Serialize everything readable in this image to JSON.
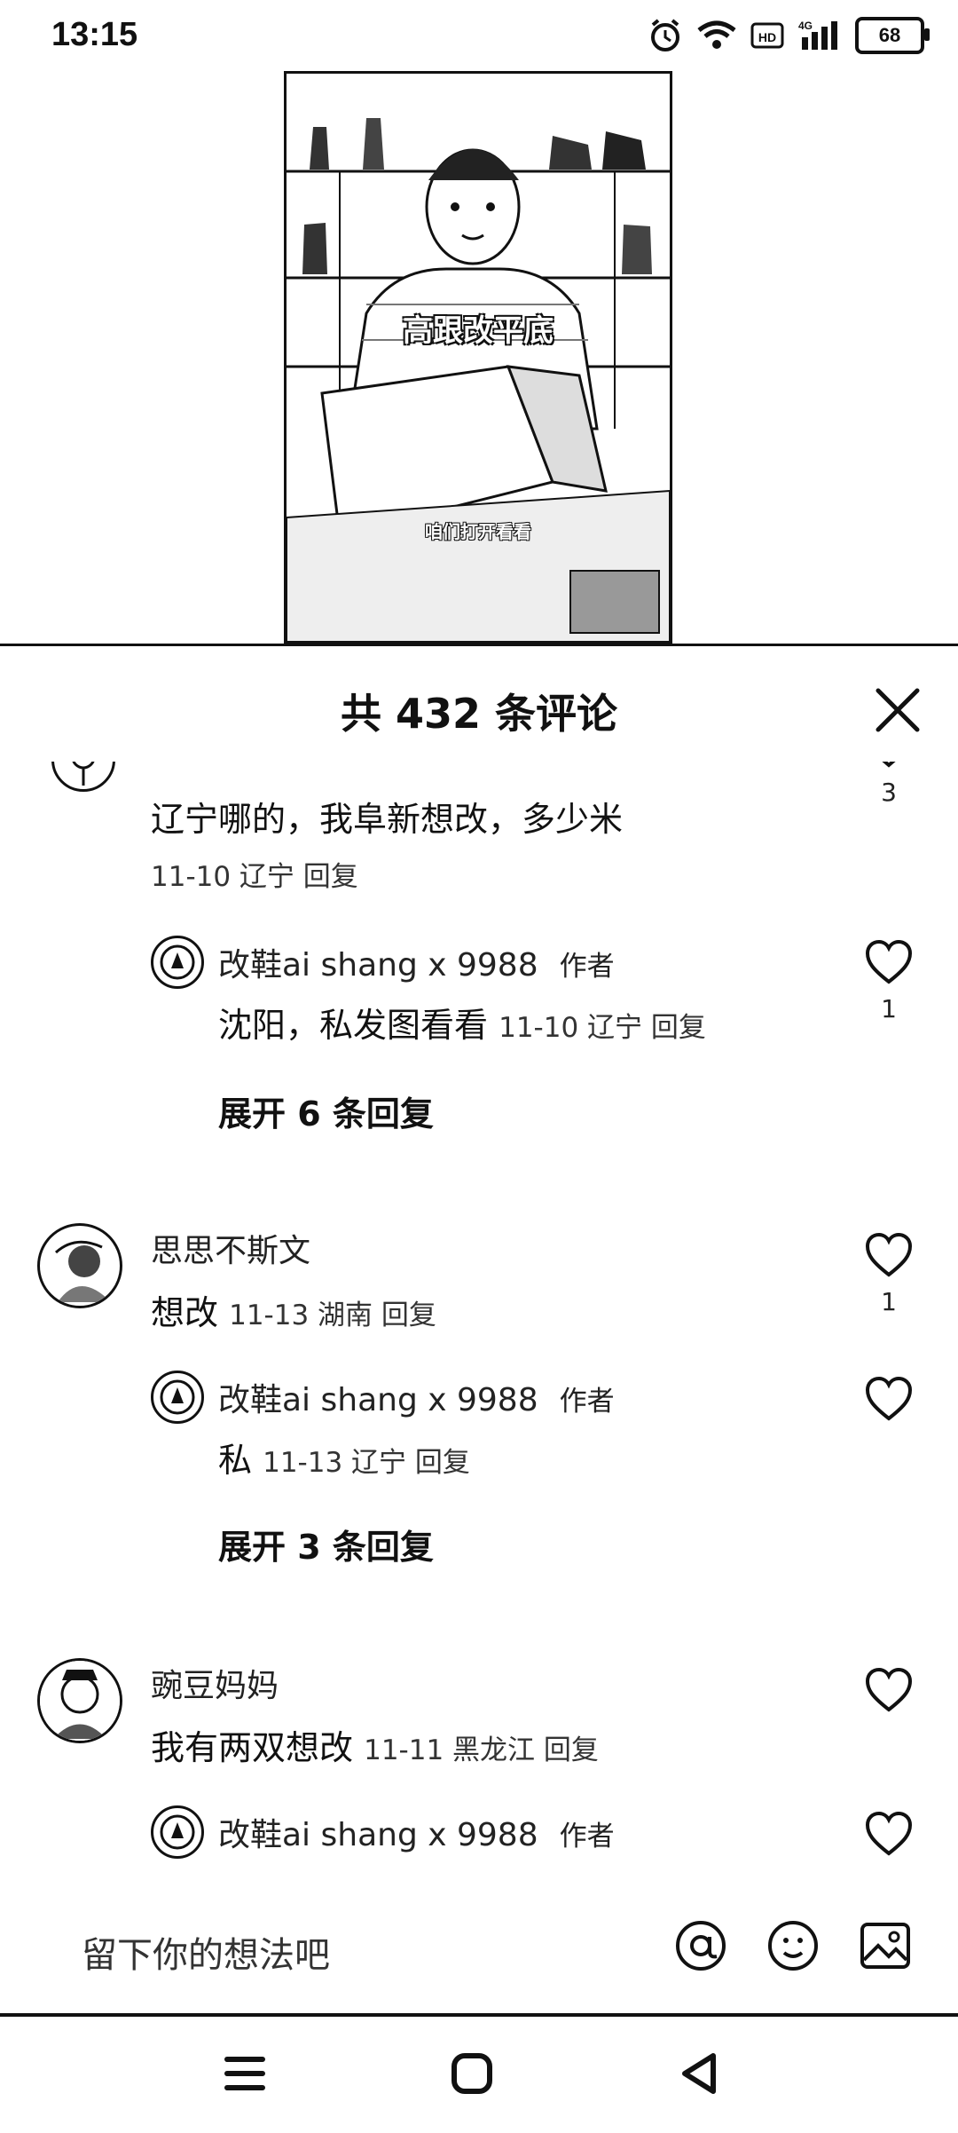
{
  "status": {
    "time": "13:15",
    "battery": "68"
  },
  "video": {
    "caption_main": "高跟改平底",
    "caption_sub": "咱们打开看看"
  },
  "comments_sheet": {
    "title": "共 432 条评论",
    "items": [
      {
        "text": "辽宁哪的，我阜新想改，多少米",
        "meta": "11-10 辽宁 回复",
        "likes": "3",
        "reply": {
          "name": "改鞋ai shang x 9988",
          "author_tag": "作者",
          "text": "沈阳，私发图看看",
          "meta": "11-10 辽宁 回复",
          "likes": "1"
        },
        "expand": "展开 6 条回复"
      },
      {
        "name": "思思不斯文",
        "text": "想改",
        "meta": "11-13 湖南 回复",
        "likes": "1",
        "reply": {
          "name": "改鞋ai shang x 9988",
          "author_tag": "作者",
          "text": "私",
          "meta": "11-13 辽宁 回复"
        },
        "expand": "展开 3 条回复"
      },
      {
        "name": "豌豆妈妈",
        "text": "我有两双想改",
        "meta": "11-11 黑龙江 回复",
        "reply": {
          "name": "改鞋ai shang x 9988",
          "author_tag": "作者"
        }
      }
    ]
  },
  "input": {
    "placeholder": "留下你的想法吧"
  }
}
